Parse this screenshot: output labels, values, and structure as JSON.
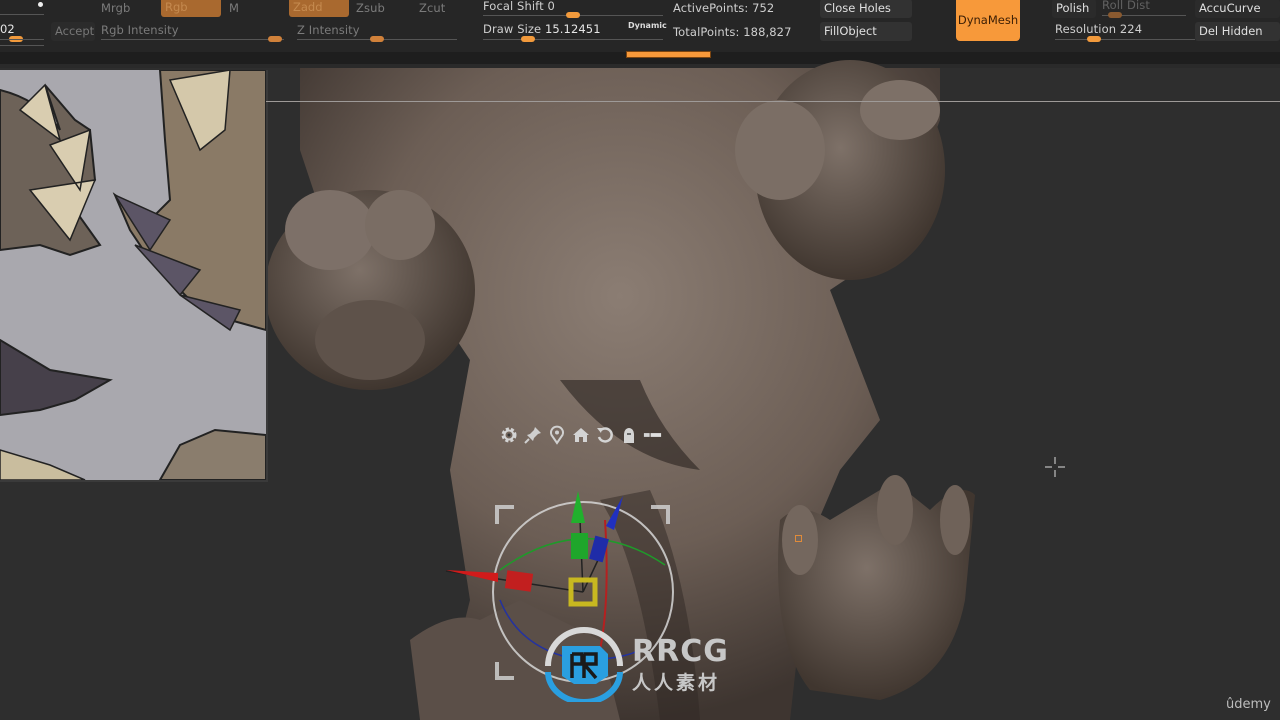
{
  "toolbar": {
    "left_value": "02",
    "accept_label": "Accept",
    "mrgb_label": "Mrgb",
    "rgb_label": "Rgb",
    "m_label": "M",
    "rgb_intensity_label": "Rgb Intensity",
    "zadd_label": "Zadd",
    "zsub_label": "Zsub",
    "zcut_label": "Zcut",
    "z_intensity_label": "Z Intensity",
    "focal_shift_label": "Focal Shift",
    "focal_shift_value": "0",
    "draw_size_label": "Draw Size",
    "draw_size_value": "15.12451",
    "dynamic_label": "Dynamic",
    "active_points_label": "ActivePoints:",
    "active_points_value": "752",
    "total_points_label": "TotalPoints:",
    "total_points_value": "188,827",
    "close_holes_label": "Close Holes",
    "fill_object_label": "FillObject",
    "dynamesh_label": "DynaMesh",
    "polish_label": "Polish",
    "roll_dist_label": "Roll Dist",
    "resolution_label": "Resolution",
    "resolution_value": "224",
    "accucurve_label": "AccuCurve",
    "del_hidden_label": "Del Hidden"
  },
  "sliders": {
    "rgb_intensity": 0.95,
    "z_intensity": 0.5,
    "focal_shift": 0.5,
    "draw_size": 0.25,
    "resolution": 0.28,
    "roll_dist": 0.15
  },
  "progress": {
    "active": true
  },
  "gizmo": {
    "icons": [
      "gear-icon",
      "pin-icon",
      "location-icon",
      "home-icon",
      "reset-icon",
      "lock-icon",
      "toggle-icon"
    ]
  },
  "watermark": {
    "main": "RRCG",
    "sub": "人人素材"
  },
  "branding": {
    "udemy": "ûdemy"
  },
  "colors": {
    "accent_orange": "#f7993a",
    "toolbar_bg": "#262626",
    "viewport_bg": "#2e2e2e",
    "model_clay": "#6e6058"
  }
}
